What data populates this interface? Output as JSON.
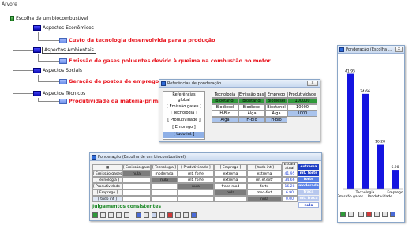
{
  "app": {
    "title": "Árvore"
  },
  "tree": {
    "root": "Escolha de um biocombustível",
    "criteria": [
      {
        "label": "Aspectos Econômicos",
        "leaf": "Custo da tecnologia desenvolvida para a produção"
      },
      {
        "label": "Aspectos Ambientais",
        "leaf": "Emissão de gases poluentes devido à queima na combustão no motor"
      },
      {
        "label": "Aspectos Sociais",
        "leaf": "Geração de postos de emprego"
      },
      {
        "label": "Aspectos Técnicos",
        "leaf": "Produtividade da matéria-prima"
      }
    ]
  },
  "ref_dialog": {
    "title": "Referências de ponderação",
    "close": "x",
    "left_header": [
      "Referências",
      "global"
    ],
    "left_items": [
      "[ Emissão gases ]",
      "[ Tecnologia ]",
      "[ Produtividade ]",
      "[ Emprego ]",
      "[ tudo int ]"
    ],
    "columns": [
      "Tecnologia",
      "Emissão gases",
      "Emprego",
      "Produtividade"
    ],
    "rows": [
      [
        "Bioetanol",
        "Bioetanol",
        "Biodiesel",
        "100000"
      ],
      [
        "Biodiesel",
        "Biodiesel",
        "Bioetanol",
        "10000"
      ],
      [
        "H-Bio",
        "Alga",
        "Alga",
        "1000"
      ],
      [
        "Alga",
        "H-Bio",
        "H-Bio",
        ""
      ]
    ]
  },
  "pair_dialog": {
    "title": "Ponderação (Escolha de um biocombustível)",
    "columns": [
      "[ Emissão gases ]",
      "[ Tecnologia ]",
      "[ Produtividade ]",
      "[ Emprego ]",
      "[ tudo int ]",
      "Escala atual"
    ],
    "rows": [
      {
        "label": "[ Emissão gases ]",
        "cells": [
          "nula",
          "moderada",
          "mt. forte",
          "extrema",
          "extrema"
        ],
        "score": "41.95",
        "badge": "extrema"
      },
      {
        "label": "[ Tecnologia ]",
        "cells": [
          "",
          "nula",
          "mt. forte",
          "extrema",
          "mt.ef.extr"
        ],
        "score": "34.66",
        "badge": "mt. forte"
      },
      {
        "label": "[ Produtividade ]",
        "cells": [
          "",
          "",
          "nula",
          "fraca mod",
          "forte"
        ],
        "score": "16.28",
        "badge": "forte"
      },
      {
        "label": "[ Emprego ]",
        "cells": [
          "",
          "",
          "",
          "nula",
          "mod-fort"
        ],
        "score": "6.90",
        "badge": "moderada"
      },
      {
        "label": "[ tudo int ]",
        "cells": [
          "",
          "",
          "",
          "",
          "nula"
        ],
        "score": "0.00",
        "badge": "fraca"
      }
    ],
    "extra_badges": [
      "mt. fraca",
      "nula"
    ],
    "status": "Julgamentos consistentes"
  },
  "chart_dialog": {
    "title": "Ponderação (Escolha ...",
    "close": "x"
  },
  "chart_data": {
    "type": "bar",
    "categories": [
      "Emissão gases",
      "Tecnologia",
      "Produtividade",
      "Emprego"
    ],
    "values": [
      41.95,
      34.66,
      16.28,
      6.9
    ],
    "value_labels": [
      "41.95",
      "34.66",
      "16.28",
      "6.90"
    ],
    "bar_color": "#1414e0",
    "ylim": [
      0,
      45
    ]
  }
}
